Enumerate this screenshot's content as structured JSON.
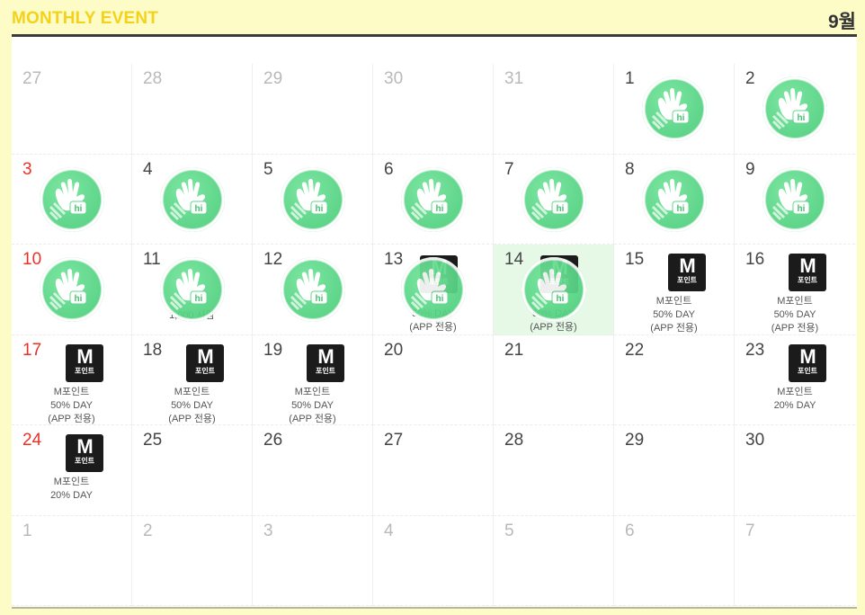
{
  "header": {
    "title": "MONTHLY EVENT",
    "month": "9월"
  },
  "colors": {
    "accent_yellow": "#f5d21a",
    "background": "#fdfbc6",
    "sunday_red": "#e83228",
    "stamp_green": "#56d484",
    "today_bg": "#e6f9e6"
  },
  "stamp_text": "hi",
  "mpoint_badge": {
    "big": "M",
    "small": "포인트"
  },
  "weeks": [
    [
      {
        "day": "27",
        "other": true
      },
      {
        "day": "28",
        "other": true
      },
      {
        "day": "29",
        "other": true
      },
      {
        "day": "30",
        "other": true
      },
      {
        "day": "31",
        "other": true
      },
      {
        "day": "1",
        "stamp": true
      },
      {
        "day": "2",
        "stamp": true
      }
    ],
    [
      {
        "day": "3",
        "sun": true,
        "stamp": true
      },
      {
        "day": "4",
        "stamp": true
      },
      {
        "day": "5",
        "stamp": true
      },
      {
        "day": "6",
        "stamp": true
      },
      {
        "day": "7",
        "stamp": true
      },
      {
        "day": "8",
        "stamp": true
      },
      {
        "day": "9",
        "stamp": true
      }
    ],
    [
      {
        "day": "10",
        "sun": true,
        "stamp": true
      },
      {
        "day": "11",
        "stamp": true,
        "note": [
          "1,000 사람"
        ]
      },
      {
        "day": "12",
        "stamp": true
      },
      {
        "day": "13",
        "stamp": true,
        "mpoint": [
          "50% DAY",
          "(APP 전용)"
        ]
      },
      {
        "day": "14",
        "stamp": true,
        "today": true,
        "mpoint": [
          "50% DAY",
          "(APP 전용)"
        ]
      },
      {
        "day": "15",
        "mpoint": [
          "M포인트",
          "50% DAY",
          "(APP 전용)"
        ]
      },
      {
        "day": "16",
        "mpoint": [
          "M포인트",
          "50% DAY",
          "(APP 전용)"
        ]
      }
    ],
    [
      {
        "day": "17",
        "sun": true,
        "mpoint": [
          "M포인트",
          "50% DAY",
          "(APP 전용)"
        ]
      },
      {
        "day": "18",
        "mpoint": [
          "M포인트",
          "50% DAY",
          "(APP 전용)"
        ]
      },
      {
        "day": "19",
        "mpoint": [
          "M포인트",
          "50% DAY",
          "(APP 전용)"
        ]
      },
      {
        "day": "20"
      },
      {
        "day": "21"
      },
      {
        "day": "22"
      },
      {
        "day": "23",
        "mpoint": [
          "M포인트",
          "20% DAY"
        ]
      }
    ],
    [
      {
        "day": "24",
        "sun": true,
        "mpoint": [
          "M포인트",
          "20% DAY"
        ]
      },
      {
        "day": "25"
      },
      {
        "day": "26"
      },
      {
        "day": "27"
      },
      {
        "day": "28"
      },
      {
        "day": "29"
      },
      {
        "day": "30"
      }
    ],
    [
      {
        "day": "1",
        "other": true
      },
      {
        "day": "2",
        "other": true
      },
      {
        "day": "3",
        "other": true
      },
      {
        "day": "4",
        "other": true
      },
      {
        "day": "5",
        "other": true
      },
      {
        "day": "6",
        "other": true
      },
      {
        "day": "7",
        "other": true
      }
    ]
  ]
}
